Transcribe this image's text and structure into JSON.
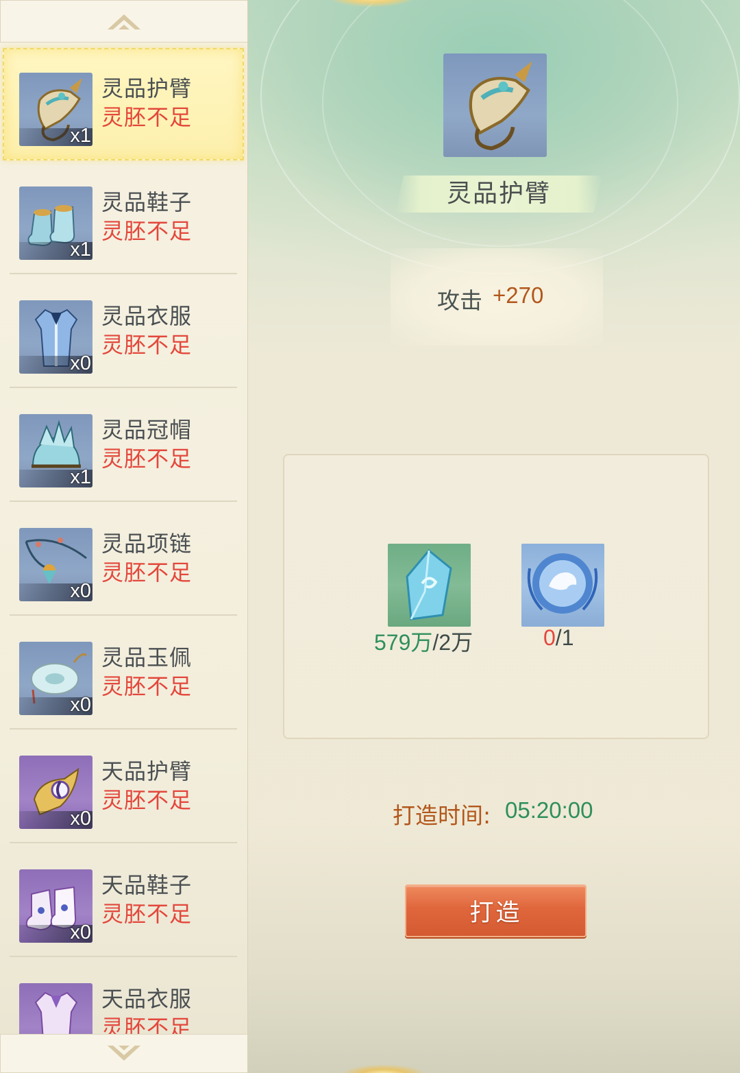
{
  "sidebar": {
    "items": [
      {
        "name": "灵品护臂",
        "status": "灵胚不足",
        "count": "x1"
      },
      {
        "name": "灵品鞋子",
        "status": "灵胚不足",
        "count": "x1"
      },
      {
        "name": "灵品衣服",
        "status": "灵胚不足",
        "count": "x0"
      },
      {
        "name": "灵品冠帽",
        "status": "灵胚不足",
        "count": "x1"
      },
      {
        "name": "灵品项链",
        "status": "灵胚不足",
        "count": "x0"
      },
      {
        "name": "灵品玉佩",
        "status": "灵胚不足",
        "count": "x0"
      },
      {
        "name": "天品护臂",
        "status": "灵胚不足",
        "count": "x0"
      },
      {
        "name": "天品鞋子",
        "status": "灵胚不足",
        "count": "x0"
      },
      {
        "name": "天品衣服",
        "status": "灵胚不足",
        "count": ""
      }
    ],
    "selected_index": 0
  },
  "detail": {
    "title": "灵品护臂",
    "stat": {
      "label": "攻击",
      "value": "+270"
    },
    "materials": [
      {
        "icon": "crystal-icon",
        "have": "579万",
        "sep": "/",
        "need": "2万"
      },
      {
        "icon": "dragon-orb-icon",
        "have": "0",
        "sep": "/",
        "need": "1"
      }
    ],
    "time_label": "打造时间:",
    "time_value": "05:20:00",
    "craft_button": "打造"
  },
  "colors": {
    "insufficient": "#e3473c",
    "sufficient": "#2e8f5c",
    "accent_orange": "#b2571c",
    "button": "#e0663c"
  }
}
